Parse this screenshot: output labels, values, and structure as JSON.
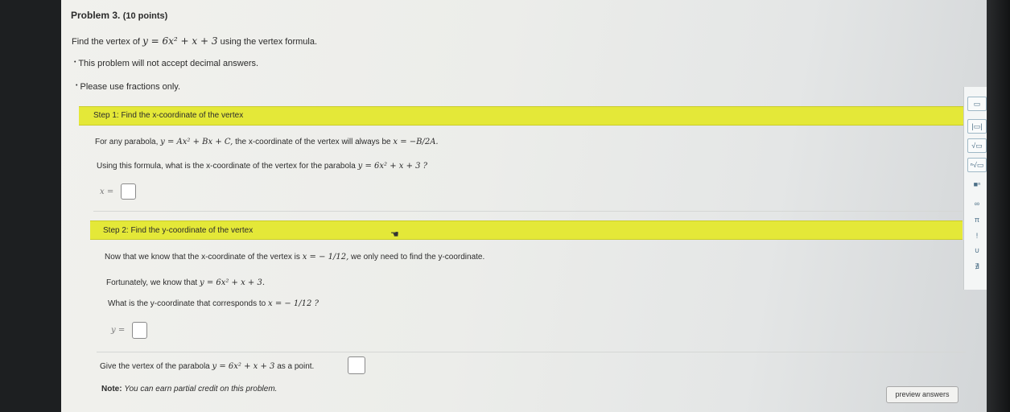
{
  "problem": {
    "title": "Problem 3.",
    "points": "(10 points)",
    "intro_prefix": "Find the vertex of",
    "intro_equation": "y = 6x² + x + 3",
    "intro_suffix": "using the vertex formula.",
    "bullet1": "This problem will not accept decimal answers.",
    "bullet2": "Please use fractions only."
  },
  "step1": {
    "header": "Step 1: Find the x-coordinate of the vertex",
    "line1_prefix": "For any parabola,",
    "line1_eq": "y = Ax² + Bx + C,",
    "line1_mid": "the x-coordinate of the vertex will always be",
    "line1_formula": "x = −B/2A.",
    "line2_prefix": "Using this formula, what is the x-coordinate of the vertex for the parabola",
    "line2_eq": "y = 6x² + x + 3 ?",
    "answer_label": "x ="
  },
  "step2": {
    "header": "Step 2: Find the y-coordinate of the vertex",
    "line1_prefix": "Now that we know that the x-coordinate of the vertex is",
    "line1_eq": "x = − 1/12,",
    "line1_suffix": "we only need to find the y-coordinate.",
    "line2_prefix": "Fortunately, we know that",
    "line2_eq": "y = 6x² + x + 3.",
    "line3_prefix": "What is the y-coordinate that corresponds to",
    "line3_eq": "x = − 1/12 ?",
    "answer_label": "y ="
  },
  "final": {
    "question_prefix": "Give the vertex of the parabola",
    "question_eq": "y = 6x² + x + 3",
    "question_suffix": "as a point.",
    "note_label": "Note:",
    "note_text": "You can earn partial credit on this problem."
  },
  "buttons": {
    "preview": "preview answers"
  },
  "toolbar": {
    "items": [
      {
        "icon": "fraction-icon",
        "glyph": "▭"
      },
      {
        "icon": "abs-value-icon",
        "glyph": "|▭|"
      },
      {
        "icon": "sqrt-icon",
        "glyph": "√▭"
      },
      {
        "icon": "nth-root-icon",
        "glyph": "ⁿ√▭"
      },
      {
        "icon": "exponent-icon",
        "glyph": "■ⁿ"
      },
      {
        "icon": "infinity-icon",
        "glyph": "∞"
      },
      {
        "icon": "pi-icon",
        "glyph": "π"
      },
      {
        "icon": "factorial-icon",
        "glyph": "!"
      },
      {
        "icon": "union-icon",
        "glyph": "∪"
      },
      {
        "icon": "dne-icon",
        "glyph": "∄"
      }
    ]
  },
  "colors": {
    "step_header": "#e4e838",
    "toolbar_icon": "#4a6e86"
  }
}
